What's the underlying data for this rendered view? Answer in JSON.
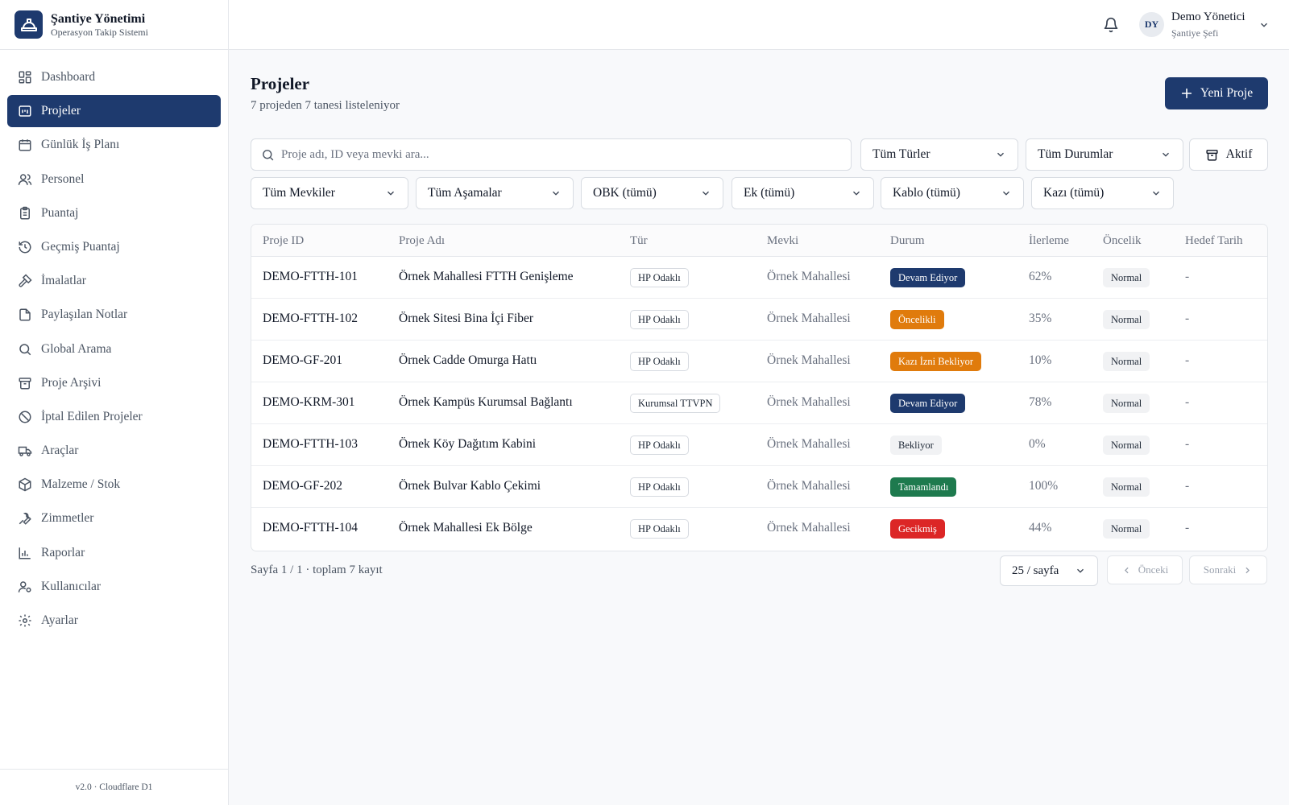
{
  "brand": {
    "title": "Şantiye Yönetimi",
    "subtitle": "Operasyon Takip Sistemi",
    "icon": "hard-hat-icon"
  },
  "sidebar": {
    "items": [
      {
        "label": "Dashboard",
        "icon": "grid-icon",
        "active": false
      },
      {
        "label": "Projeler",
        "icon": "board-icon",
        "active": true
      },
      {
        "label": "Günlük İş Planı",
        "icon": "calendar-icon",
        "active": false
      },
      {
        "label": "Personel",
        "icon": "users-icon",
        "active": false
      },
      {
        "label": "Puantaj",
        "icon": "clipboard-icon",
        "active": false
      },
      {
        "label": "Geçmiş Puantaj",
        "icon": "history-icon",
        "active": false
      },
      {
        "label": "İmalatlar",
        "icon": "hammer-icon",
        "active": false
      },
      {
        "label": "Paylaşılan Notlar",
        "icon": "file-icon",
        "active": false
      },
      {
        "label": "Global Arama",
        "icon": "search-icon",
        "active": false
      },
      {
        "label": "Proje Arşivi",
        "icon": "archive-icon",
        "active": false
      },
      {
        "label": "İptal Edilen Projeler",
        "icon": "ban-icon",
        "active": false
      },
      {
        "label": "Araçlar",
        "icon": "truck-icon",
        "active": false
      },
      {
        "label": "Malzeme / Stok",
        "icon": "package-icon",
        "active": false
      },
      {
        "label": "Zimmetler",
        "icon": "wrench-icon",
        "active": false
      },
      {
        "label": "Raporlar",
        "icon": "bar-chart-icon",
        "active": false
      },
      {
        "label": "Kullanıcılar",
        "icon": "user-cog-icon",
        "active": false
      },
      {
        "label": "Ayarlar",
        "icon": "gear-icon",
        "active": false
      }
    ],
    "footer": "v2.0 · Cloudflare D1"
  },
  "topbar": {
    "avatar_initials": "DY",
    "user_name": "Demo Yönetici",
    "user_role": "Şantiye Şefi"
  },
  "page": {
    "title": "Projeler",
    "subtitle": "7 projeden 7 tanesi listeleniyor",
    "new_button": "Yeni Proje"
  },
  "filters": {
    "search_placeholder": "Proje adı, ID veya mevki ara...",
    "type": "Tüm Türler",
    "status": "Tüm Durumlar",
    "archive_toggle": "Aktif",
    "location": "Tüm Mevkiler",
    "phase": "Tüm Aşamalar",
    "obk": "OBK (tümü)",
    "ek": "Ek (tümü)",
    "kablo": "Kablo (tümü)",
    "kazi": "Kazı (tümü)"
  },
  "table": {
    "headers": [
      "Proje ID",
      "Proje Adı",
      "Tür",
      "Mevki",
      "Durum",
      "İlerleme",
      "Öncelik",
      "Hedef Tarih"
    ],
    "status_colors": {
      "Devam Ediyor": "#1e3a6e",
      "Öncelikli": "#e07b0c",
      "Kazı İzni Bekliyor": "#e07b0c",
      "Bekliyor": "#f1f2f4",
      "Tamamlandı": "#1e7a4e",
      "Gecikmiş": "#dc2626"
    },
    "rows": [
      {
        "id": "DEMO-FTTH-101",
        "name": "Örnek Mahallesi FTTH Genişleme",
        "type": "HP Odaklı",
        "location": "Örnek Mahallesi",
        "status": "Devam Ediyor",
        "progress": "62%",
        "priority": "Normal",
        "target": "-"
      },
      {
        "id": "DEMO-FTTH-102",
        "name": "Örnek Sitesi Bina İçi Fiber",
        "type": "HP Odaklı",
        "location": "Örnek Mahallesi",
        "status": "Öncelikli",
        "progress": "35%",
        "priority": "Normal",
        "target": "-"
      },
      {
        "id": "DEMO-GF-201",
        "name": "Örnek Cadde Omurga Hattı",
        "type": "HP Odaklı",
        "location": "Örnek Mahallesi",
        "status": "Kazı İzni Bekliyor",
        "progress": "10%",
        "priority": "Normal",
        "target": "-"
      },
      {
        "id": "DEMO-KRM-301",
        "name": "Örnek Kampüs Kurumsal Bağlantı",
        "type": "Kurumsal TTVPN",
        "location": "Örnek Mahallesi",
        "status": "Devam Ediyor",
        "progress": "78%",
        "priority": "Normal",
        "target": "-"
      },
      {
        "id": "DEMO-FTTH-103",
        "name": "Örnek Köy Dağıtım Kabini",
        "type": "HP Odaklı",
        "location": "Örnek Mahallesi",
        "status": "Bekliyor",
        "progress": "0%",
        "priority": "Normal",
        "target": "-"
      },
      {
        "id": "DEMO-GF-202",
        "name": "Örnek Bulvar Kablo Çekimi",
        "type": "HP Odaklı",
        "location": "Örnek Mahallesi",
        "status": "Tamamlandı",
        "progress": "100%",
        "priority": "Normal",
        "target": "-"
      },
      {
        "id": "DEMO-FTTH-104",
        "name": "Örnek Mahallesi Ek Bölge",
        "type": "HP Odaklı",
        "location": "Örnek Mahallesi",
        "status": "Gecikmiş",
        "progress": "44%",
        "priority": "Normal",
        "target": "-"
      }
    ]
  },
  "pagination": {
    "info": "Sayfa 1 / 1 · toplam 7 kayıt",
    "page_size": "25 / sayfa",
    "prev": "Önceki",
    "next": "Sonraki"
  }
}
